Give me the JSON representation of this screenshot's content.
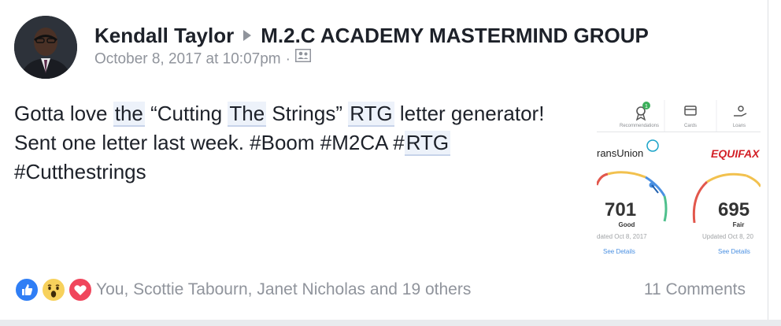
{
  "post": {
    "author": "Kendall Taylor",
    "group": "M.2.C ACADEMY MASTERMIND GROUP",
    "timestamp": "October 8, 2017 at 10:07pm",
    "separator": "·",
    "privacy_icon": "members-icon"
  },
  "body": {
    "t1": "Gotta love ",
    "h1": "the",
    "t2": " “Cutting ",
    "h2": "The",
    "t3": " Strings” ",
    "h3": "RTG",
    "t4": " letter generator! Sent one letter last week. #Boom #M2CA ",
    "t5": "#",
    "h4": "RTG",
    "t6": " #Cutthestrings"
  },
  "attachment": {
    "tabs": [
      {
        "label": "Recommendations",
        "icon": "ribbon-icon",
        "badge": "1"
      },
      {
        "label": "Cards",
        "icon": "card-icon"
      },
      {
        "label": "Loans",
        "icon": "loans-icon"
      }
    ],
    "bureaus": [
      {
        "name": "ransUnion",
        "score": "701",
        "rating": "Good",
        "updated": "dated Oct 8, 2017",
        "link": "See Details"
      },
      {
        "name": "EQUIFAX",
        "score": "695",
        "rating": "Fair",
        "updated": "Updated Oct 8, 20",
        "link": "See Details"
      }
    ]
  },
  "footer": {
    "reaction_icons": [
      "like-icon",
      "wow-icon",
      "love-icon"
    ],
    "names": "You, Scottie Tabourn, Janet Nicholas and 19 others",
    "comments": "11 Comments"
  },
  "colors": {
    "text": "#1d2129",
    "meta": "#90949c",
    "link_highlight": "#edf2fa",
    "like": "#2f7ef5",
    "love": "#f0465c",
    "wow": "#f7d15c",
    "equifax": "#d32027",
    "link_blue": "#4a90e2"
  }
}
